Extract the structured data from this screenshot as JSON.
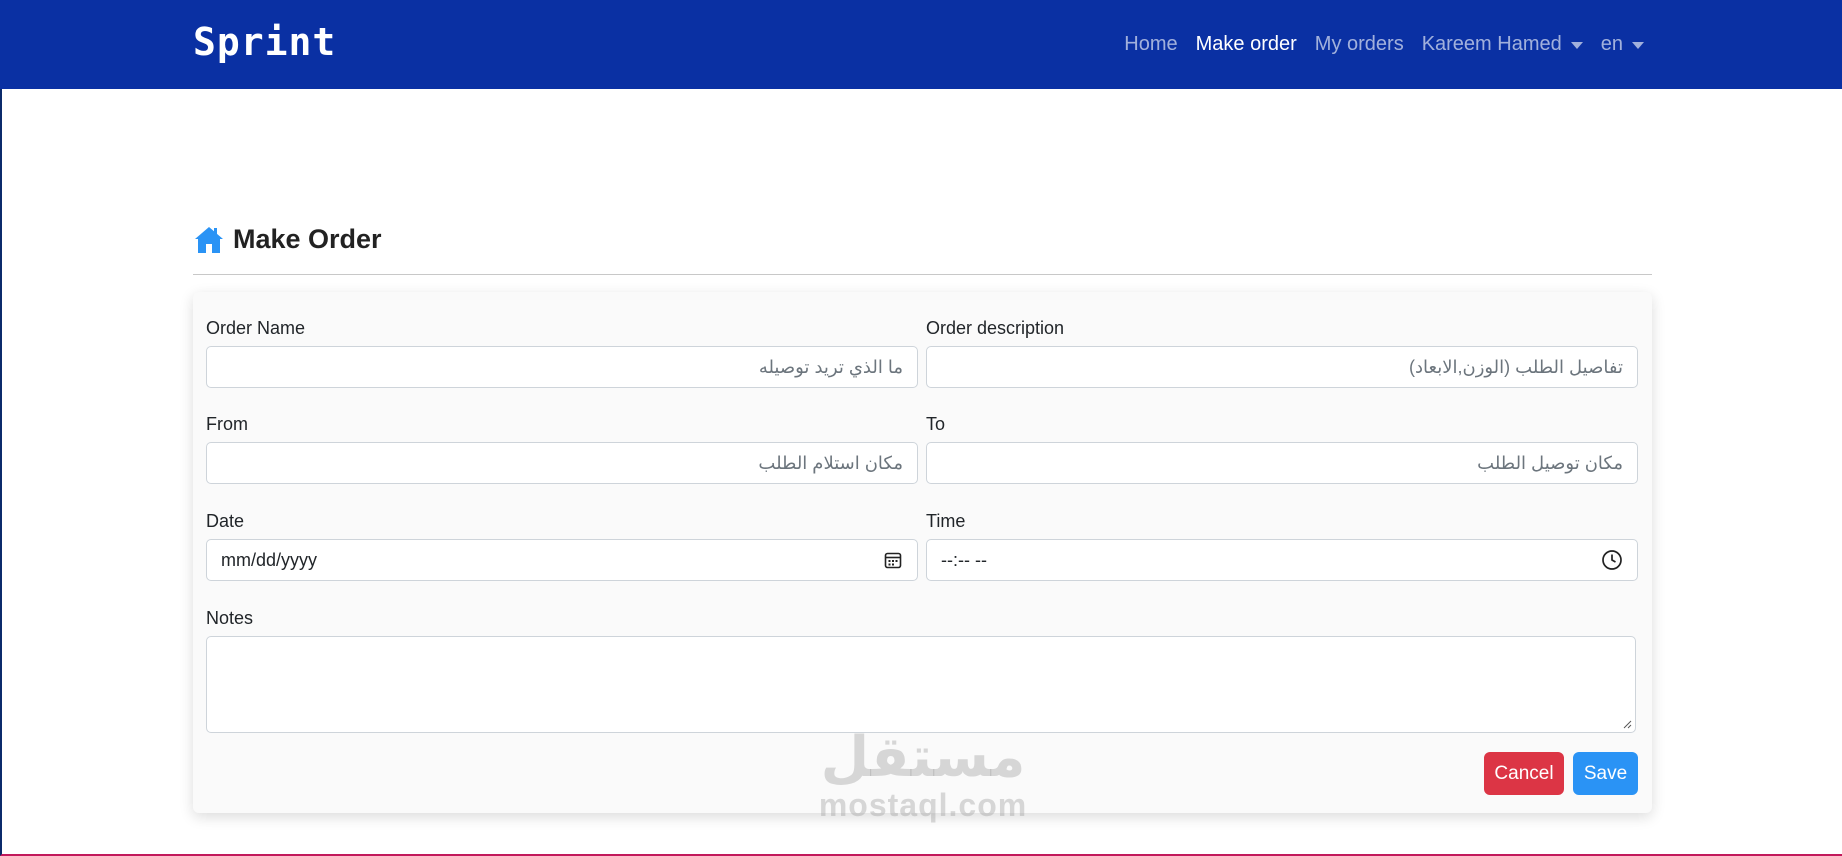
{
  "navbar": {
    "brand": "Sprint",
    "links": [
      {
        "label": "Home",
        "active": false
      },
      {
        "label": "Make order",
        "active": true
      },
      {
        "label": "My orders",
        "active": false
      }
    ],
    "user_menu": "Kareem Hamed",
    "language": "en"
  },
  "page": {
    "title": "Make Order",
    "title_icon": "home-icon"
  },
  "form": {
    "order_name": {
      "label": "Order Name",
      "placeholder": "ما الذي تريد توصيله"
    },
    "order_description": {
      "label": "Order description",
      "placeholder": "تفاصيل الطلب (الوزن,الابعاد)"
    },
    "from": {
      "label": "From",
      "placeholder": "مكان استلام الطلب"
    },
    "to": {
      "label": "To",
      "placeholder": "مكان توصيل الطلب"
    },
    "date": {
      "label": "Date",
      "value": "mm/dd/yyyy",
      "icon": "calendar-icon"
    },
    "time": {
      "label": "Time",
      "value": "--:-- --",
      "icon": "clock-icon"
    },
    "notes": {
      "label": "Notes",
      "value": ""
    },
    "cancel_label": "Cancel",
    "save_label": "Save"
  },
  "watermark": {
    "arabic": "مستقل",
    "latin": "mostaql.com"
  },
  "colors": {
    "navbar": "#0a30a3",
    "cancel": "#dc3545",
    "save": "#2a93f5",
    "home_icon": "#2a93f5"
  }
}
